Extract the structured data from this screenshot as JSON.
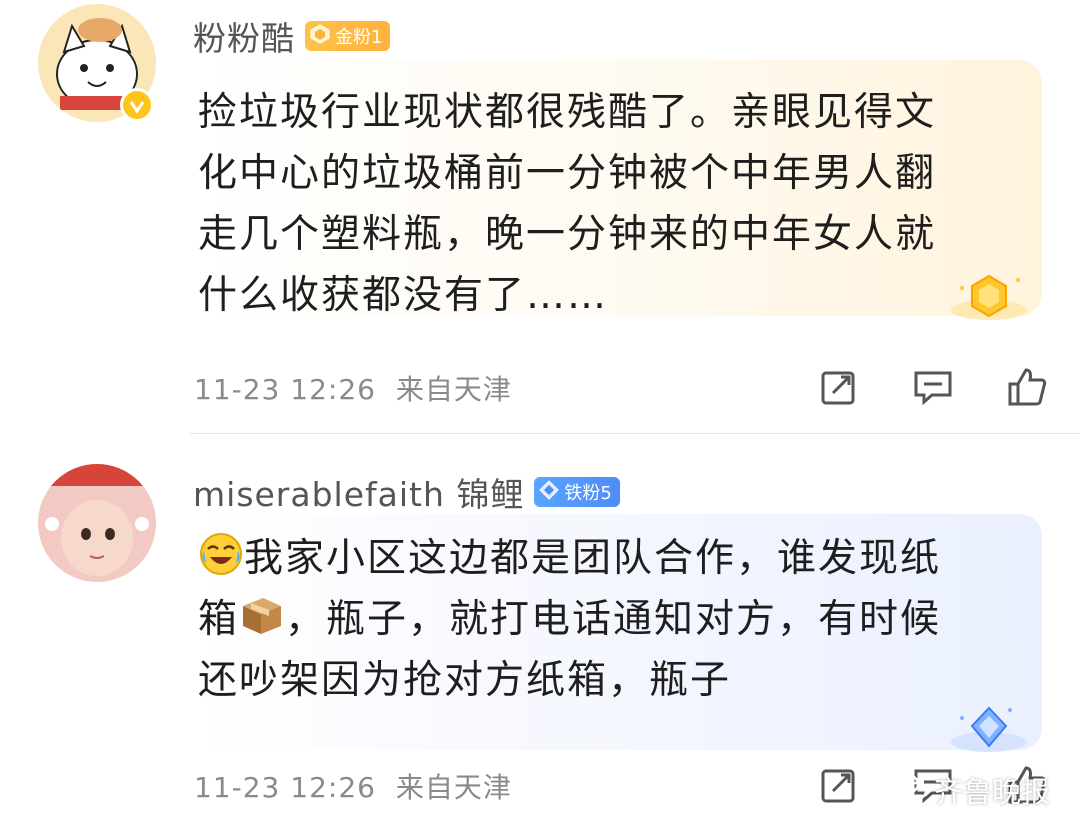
{
  "comments": [
    {
      "username": "粉粉酷",
      "badge_label": "金粉1",
      "badge_icon": "gold-crown-icon",
      "verified": true,
      "lines": [
        "捡垃圾行业现状都很残酷了。亲眼见得文",
        "化中心的垃圾桶前一分钟被个中年男人翻",
        "走几个塑料瓶，晚一分钟来的中年女人就",
        "什么收获都没有了……"
      ],
      "timestamp": "11-23 12:26",
      "location": "来自天津",
      "accent": "#ffb23c"
    },
    {
      "username": "miserablefaith 锦鲤",
      "badge_label": "铁粉5",
      "badge_icon": "diamond-icon",
      "verified": false,
      "line1_text": "我家小区这边都是团队合作，谁发现纸",
      "line2_pre": "箱",
      "line2_post": "，瓶子，就打电话通知对方，有时候",
      "line3": "还吵架因为抢对方纸箱，瓶子",
      "timestamp": "11-23 12:26",
      "location": "来自天津",
      "accent": "#4f8cf5"
    }
  ],
  "watermark": "齐鲁晚报"
}
